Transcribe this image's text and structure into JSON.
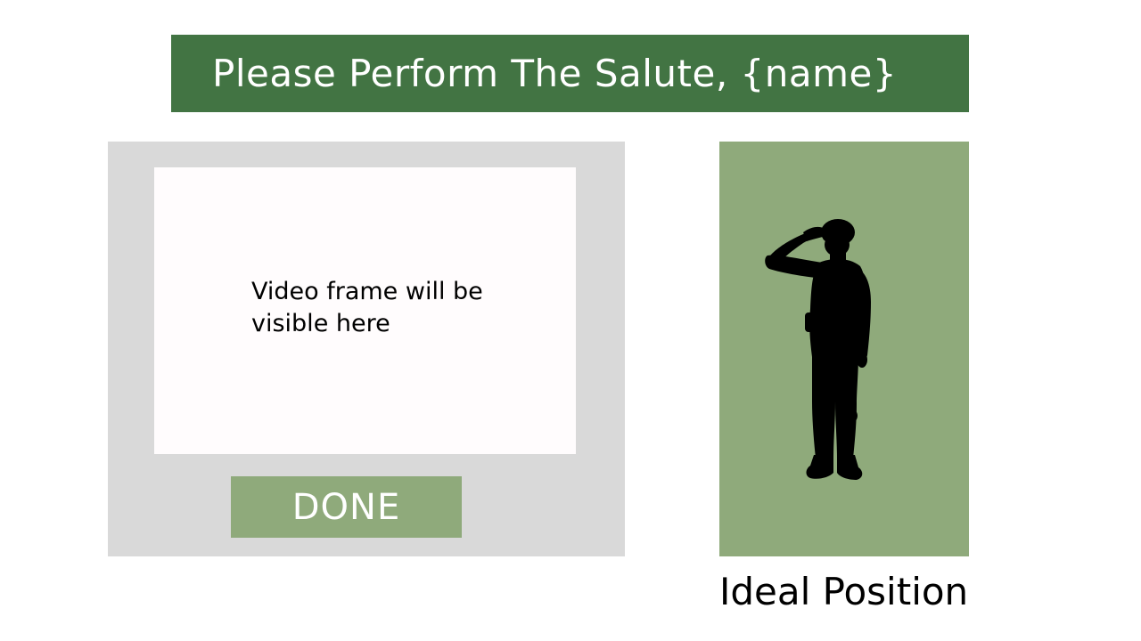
{
  "header": {
    "title": "Please Perform The Salute, {name}"
  },
  "video": {
    "placeholder": "Video frame will be visible here"
  },
  "actions": {
    "done_label": "DONE"
  },
  "reference": {
    "caption": "Ideal Position",
    "icon": "saluting-soldier-silhouette"
  },
  "colors": {
    "header_bg": "#427443",
    "accent_green": "#8faa7b",
    "panel_gray": "#d9d9d9",
    "frame_bg": "#fffcfd"
  }
}
